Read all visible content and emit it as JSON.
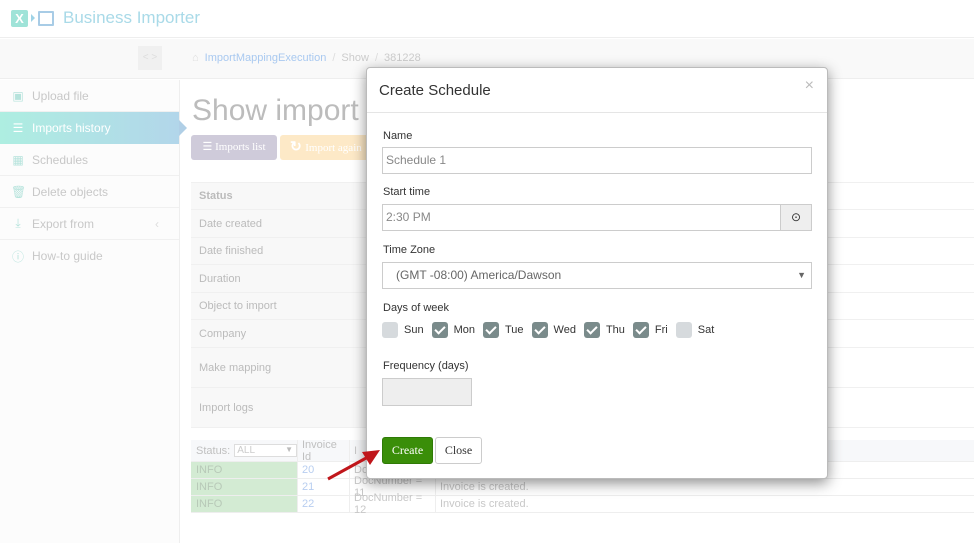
{
  "app": {
    "title": "Business Importer",
    "logo_letter": "X"
  },
  "breadcrumb": {
    "home_icon": "home-icon",
    "items": [
      "ImportMappingExecution",
      "Show",
      "381228"
    ],
    "separator": "/"
  },
  "nav_toggle": {
    "label": "< >"
  },
  "sidebar": {
    "items": [
      {
        "label": "Upload file",
        "icon": "excel-file-icon",
        "glyph": "▣",
        "active": false
      },
      {
        "label": "Imports history",
        "icon": "list-icon",
        "glyph": "☰",
        "active": true
      },
      {
        "label": "Schedules",
        "icon": "calendar-icon",
        "glyph": "▦",
        "active": false
      },
      {
        "label": "Delete objects",
        "icon": "trash-icon",
        "glyph": "🗑",
        "active": false
      },
      {
        "label": "Export from",
        "icon": "download-icon",
        "glyph": "⤓",
        "active": false,
        "chevron": "‹"
      },
      {
        "label": "How-to guide",
        "icon": "info-icon",
        "glyph": "ⓘ",
        "active": false
      }
    ]
  },
  "main": {
    "title": "Show import r",
    "buttons": {
      "imports_list": "Imports list",
      "import_again": "Import again"
    },
    "details_rows": [
      "Status",
      "Date created",
      "Date finished",
      "Duration",
      "Object to import",
      "Company",
      "Make mapping",
      "Import logs"
    ],
    "logs_table": {
      "status_filter_label": "Status:",
      "status_filter_value": "ALL",
      "headers": [
        "Invoice Id",
        "I"
      ],
      "rows": [
        {
          "status": "INFO",
          "invoice_id": "20",
          "doc": "Doc",
          "message": ""
        },
        {
          "status": "INFO",
          "invoice_id": "21",
          "doc": "DocNumber = 11",
          "message": "Invoice is created."
        },
        {
          "status": "INFO",
          "invoice_id": "22",
          "doc": "DocNumber = 12",
          "message": "Invoice is created."
        }
      ]
    }
  },
  "modal": {
    "title": "Create Schedule",
    "close_glyph": "×",
    "name": {
      "label": "Name",
      "value": "Schedule 1"
    },
    "start_time": {
      "label": "Start time",
      "value": "2:30 PM",
      "button_glyph": "⊙"
    },
    "time_zone": {
      "label": "Time Zone",
      "value": "(GMT -08:00) America/Dawson"
    },
    "days_of_week": {
      "label": "Days of week",
      "days": [
        {
          "label": "Sun",
          "checked": false
        },
        {
          "label": "Mon",
          "checked": true
        },
        {
          "label": "Tue",
          "checked": true
        },
        {
          "label": "Wed",
          "checked": true
        },
        {
          "label": "Thu",
          "checked": true
        },
        {
          "label": "Fri",
          "checked": true
        },
        {
          "label": "Sat",
          "checked": false
        }
      ]
    },
    "frequency": {
      "label": "Frequency (days)",
      "value": ""
    },
    "buttons": {
      "create": "Create",
      "close": "Close"
    }
  },
  "colors": {
    "create_green": "#3a8e09",
    "annotation_arrow": "#c0161b",
    "active_nav_start": "#aeeee1",
    "active_nav_end": "#b2d6ea"
  }
}
